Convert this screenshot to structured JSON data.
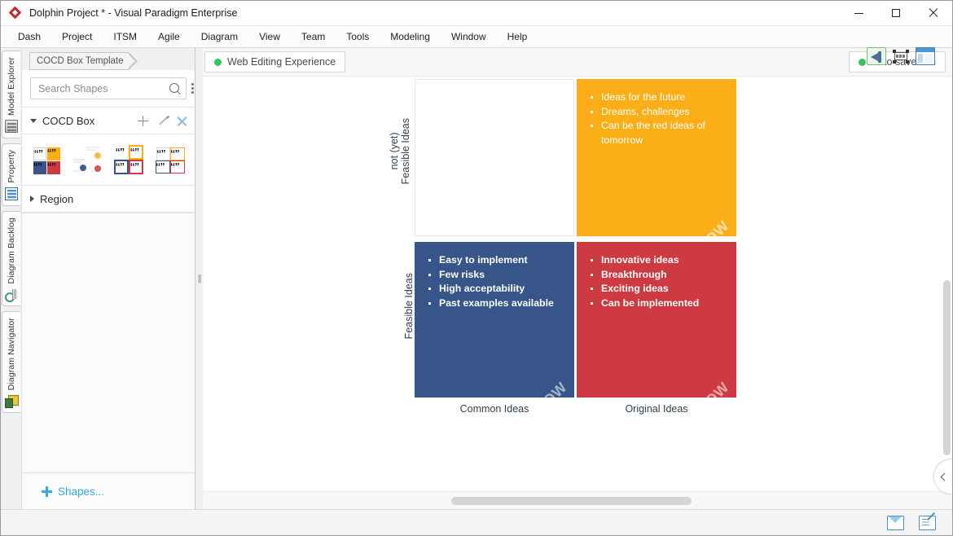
{
  "window": {
    "title": "Dolphin Project * - Visual Paradigm Enterprise",
    "logo_icon": "vp-diamond-logo-icon",
    "minimize_label": "—",
    "maximize_label": "□",
    "close_label": "✕"
  },
  "menubar": {
    "items": [
      {
        "label": "Dash"
      },
      {
        "label": "Project"
      },
      {
        "label": "ITSM"
      },
      {
        "label": "Agile"
      },
      {
        "label": "Diagram"
      },
      {
        "label": "View"
      },
      {
        "label": "Team"
      },
      {
        "label": "Tools"
      },
      {
        "label": "Modeling"
      },
      {
        "label": "Window"
      },
      {
        "label": "Help"
      }
    ]
  },
  "vertical_tabs": [
    {
      "label": "Model Explorer",
      "icon": "model-explorer-icon"
    },
    {
      "label": "Property",
      "icon": "property-icon"
    },
    {
      "label": "Diagram Backlog",
      "icon": "diagram-backlog-icon"
    },
    {
      "label": "Diagram Navigator",
      "icon": "diagram-navigator-icon"
    }
  ],
  "shapes_panel": {
    "document_tab": "COCD Box Template",
    "search": {
      "placeholder": "Search Shapes",
      "value": "",
      "icon": "search-icon",
      "overflow_icon": "kebab-menu-icon"
    },
    "group": {
      "title": "COCD Box",
      "expanded": true,
      "actions": [
        {
          "name": "add",
          "icon": "plus-icon"
        },
        {
          "name": "edit",
          "icon": "pencil-icon"
        },
        {
          "name": "delete",
          "icon": "close-x-icon"
        }
      ],
      "thumbnails": [
        {
          "name": "cocd-box-filled"
        },
        {
          "name": "cocd-box-bubbles"
        },
        {
          "name": "cocd-box-outline"
        },
        {
          "name": "cocd-box-outline-light"
        }
      ]
    },
    "region_group": {
      "title": "Region",
      "expanded": false
    },
    "footer_link": "Shapes...",
    "footer_icon": "plus-icon"
  },
  "canvas_toolbar": {
    "web_editing_badge": "Web Editing Experience",
    "web_editing_status_color": "#35c659",
    "auto_save_badge": "Auto save: On",
    "auto_save_status_color": "#35c659"
  },
  "top_right_tools": [
    {
      "name": "announcement-icon",
      "active": true
    },
    {
      "name": "fit-to-screen-icon",
      "active": false
    },
    {
      "name": "panel-layout-icon",
      "active": false
    }
  ],
  "chart_data": {
    "type": "table",
    "title": "COCD Box",
    "xlabel": "",
    "ylabel": "",
    "x_categories": [
      "Common Ideas",
      "Original Ideas"
    ],
    "y_categories": [
      "not (yet) Feasible Ideas",
      "Feasible Ideas"
    ],
    "quadrants": [
      {
        "position": "top-left",
        "x": "Common Ideas",
        "y": "not (yet) Feasible Ideas",
        "label": "",
        "color": "#ffffff",
        "border": "#e4e4e4",
        "text_color": "#333333",
        "items": []
      },
      {
        "position": "top-right",
        "x": "Original Ideas",
        "y": "not (yet) Feasible Ideas",
        "label": "HOW",
        "color": "#fbae17",
        "text_color": "#ffffff",
        "items": [
          "Ideas for the future",
          "Dreams, challenges",
          "Can be the red ideas of tomorrow"
        ]
      },
      {
        "position": "bottom-left",
        "x": "Common Ideas",
        "y": "Feasible Ideas",
        "label": "NOW",
        "color": "#375588",
        "text_color": "#ffffff",
        "items": [
          "Easy to implement",
          "Few risks",
          "High acceptability",
          "Past examples available"
        ]
      },
      {
        "position": "bottom-right",
        "x": "Original Ideas",
        "y": "Feasible Ideas",
        "label": "WOW",
        "color": "#ce3a42",
        "text_color": "#ffffff",
        "items": [
          "Innovative ideas",
          "Breakthrough",
          "Exciting ideas",
          "Can be implemented"
        ]
      }
    ],
    "axis_labels": {
      "y_top_line1": "not (yet)",
      "y_top_line2": "Feasible Ideas",
      "y_bottom": "Feasible Ideas",
      "x_left": "Common Ideas",
      "x_right": "Original Ideas"
    }
  },
  "statusbar": {
    "icons": [
      {
        "name": "mail-icon"
      },
      {
        "name": "edit-note-icon"
      }
    ]
  },
  "panel_collapse": {
    "icon": "chevron-left-icon"
  }
}
